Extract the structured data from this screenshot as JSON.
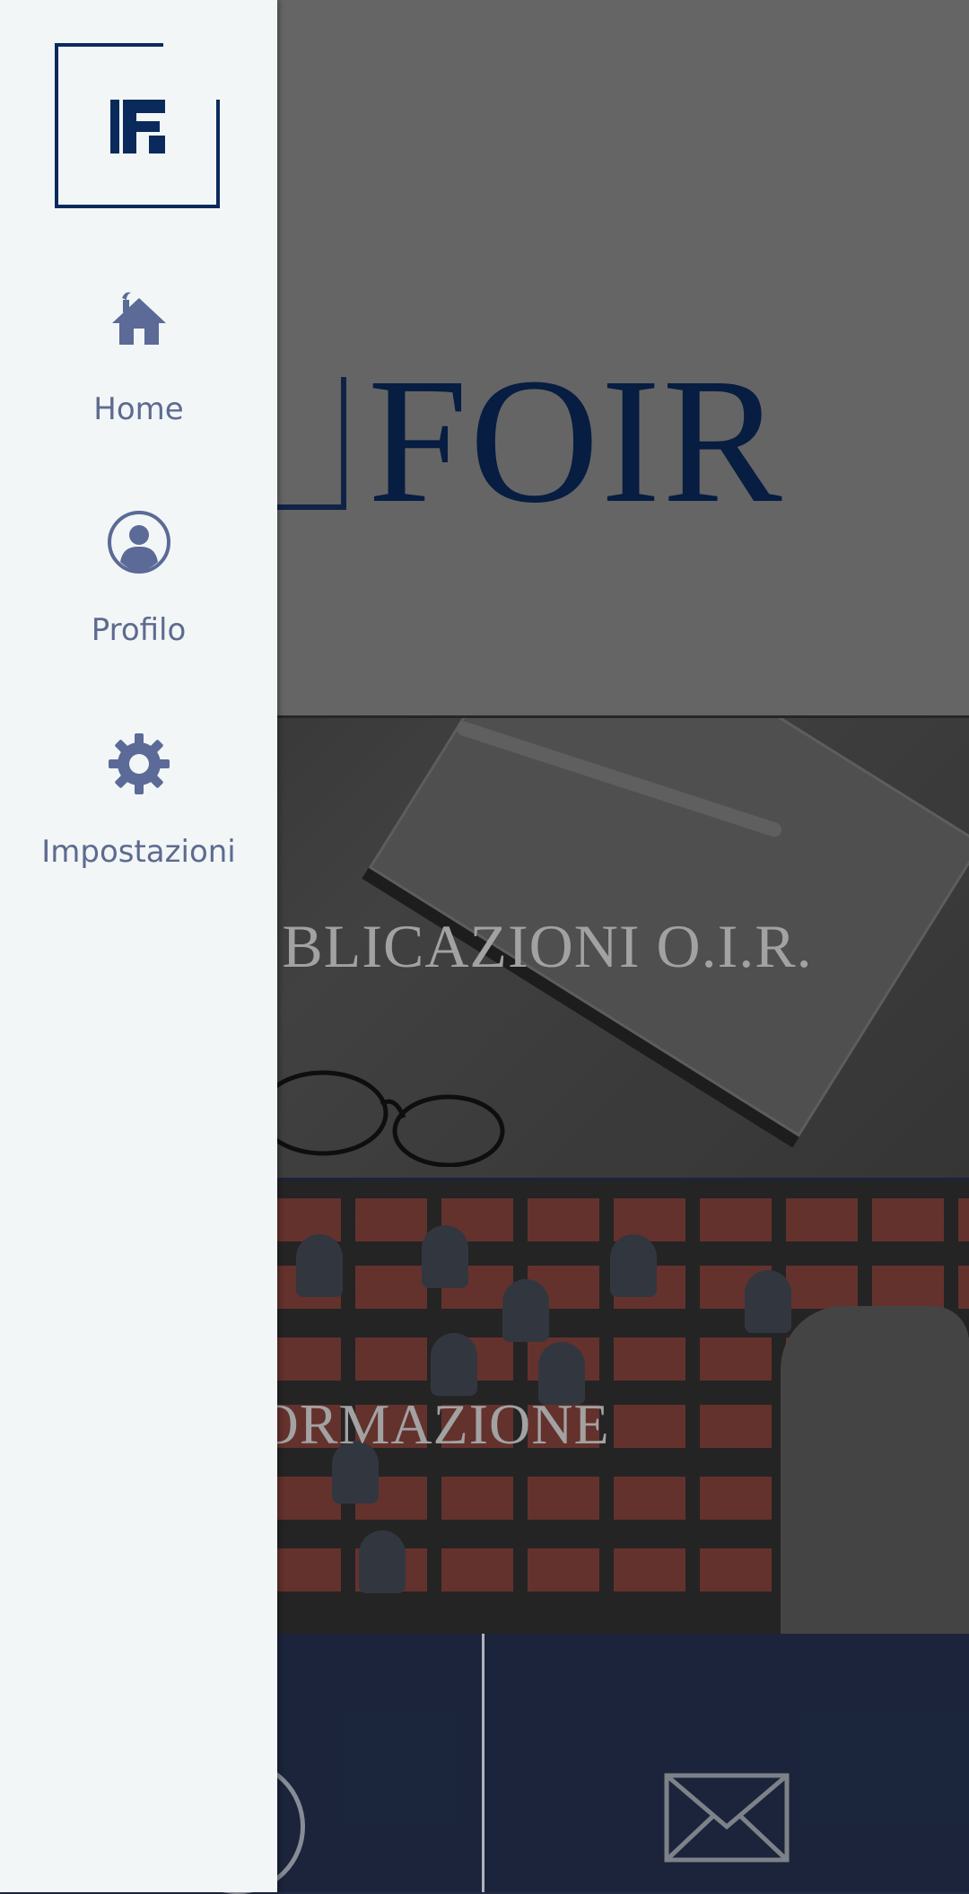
{
  "drawer": {
    "logo_icon": "app-logo-icon",
    "items": [
      {
        "label": "Home",
        "icon": "home-icon"
      },
      {
        "label": "Profilo",
        "icon": "user-circle-icon"
      },
      {
        "label": "Impostazioni",
        "icon": "gear-icon"
      }
    ],
    "accent_color": "#5e6b8f",
    "background": "#f2f6f7"
  },
  "main": {
    "hero": {
      "logo_text": "FOIR",
      "logo_color": "#08214a"
    },
    "tiles": [
      {
        "label": "BLICAZIONI O.I.R.",
        "image": "notebook-pen-glasses-photo"
      },
      {
        "label": "FORMAZIONE",
        "image": "audience-seminar-photo"
      }
    ],
    "bottom_bar": {
      "left_icon": "circle-icon",
      "right_icon": "mail-icon",
      "background": "#1f2a44"
    }
  }
}
